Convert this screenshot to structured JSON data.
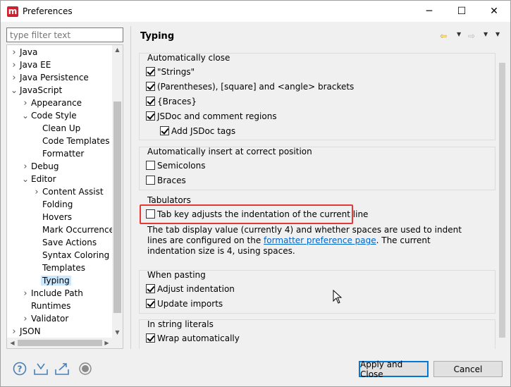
{
  "window": {
    "title": "Preferences",
    "minimize_glyph": "─",
    "maximize_glyph": "☐",
    "close_glyph": "✕",
    "app_icon_letter": "m"
  },
  "filter": {
    "placeholder": "type filter text",
    "value": ""
  },
  "tree": {
    "items": [
      {
        "label": "Java",
        "level": 0,
        "state": "collapsed"
      },
      {
        "label": "Java EE",
        "level": 0,
        "state": "collapsed"
      },
      {
        "label": "Java Persistence",
        "level": 0,
        "state": "collapsed"
      },
      {
        "label": "JavaScript",
        "level": 0,
        "state": "expanded"
      },
      {
        "label": "Appearance",
        "level": 1,
        "state": "collapsed"
      },
      {
        "label": "Code Style",
        "level": 1,
        "state": "expanded"
      },
      {
        "label": "Clean Up",
        "level": 2,
        "state": "leaf"
      },
      {
        "label": "Code Templates",
        "level": 2,
        "state": "leaf"
      },
      {
        "label": "Formatter",
        "level": 2,
        "state": "leaf"
      },
      {
        "label": "Debug",
        "level": 1,
        "state": "collapsed"
      },
      {
        "label": "Editor",
        "level": 1,
        "state": "expanded"
      },
      {
        "label": "Content Assist",
        "level": 2,
        "state": "collapsed"
      },
      {
        "label": "Folding",
        "level": 2,
        "state": "leaf"
      },
      {
        "label": "Hovers",
        "level": 2,
        "state": "leaf"
      },
      {
        "label": "Mark Occurrences",
        "level": 2,
        "state": "leaf"
      },
      {
        "label": "Save Actions",
        "level": 2,
        "state": "leaf"
      },
      {
        "label": "Syntax Coloring",
        "level": 2,
        "state": "leaf"
      },
      {
        "label": "Templates",
        "level": 2,
        "state": "leaf"
      },
      {
        "label": "Typing",
        "level": 2,
        "state": "leaf",
        "selected": true
      },
      {
        "label": "Include Path",
        "level": 1,
        "state": "collapsed"
      },
      {
        "label": "Runtimes",
        "level": 1,
        "state": "leaf"
      },
      {
        "label": "Validator",
        "level": 1,
        "state": "collapsed"
      },
      {
        "label": "JSON",
        "level": 0,
        "state": "collapsed"
      }
    ]
  },
  "page": {
    "title": "Typing",
    "back_icon": "back-arrow-icon",
    "forward_icon": "forward-arrow-icon"
  },
  "groups": {
    "auto_close": {
      "title": "Automatically close",
      "options": [
        {
          "label": "\"Strings\"",
          "checked": true
        },
        {
          "label": "(Parentheses), [square] and <angle> brackets",
          "checked": true
        },
        {
          "label": "{Braces}",
          "checked": true
        },
        {
          "label": "JSDoc and comment regions",
          "checked": true
        },
        {
          "label": "Add JSDoc tags",
          "checked": true
        }
      ]
    },
    "auto_insert": {
      "title": "Automatically insert at correct position",
      "options": [
        {
          "label": "Semicolons",
          "checked": false
        },
        {
          "label": "Braces",
          "checked": false
        }
      ]
    },
    "tabulators": {
      "title": "Tabulators",
      "option": {
        "label": "Tab key adjusts the indentation of the current line",
        "checked": false
      },
      "desc_before": "The tab display value (currently 4) and whether spaces are used to indent lines are configured on the ",
      "desc_link": "formatter preference page",
      "desc_after": ". The current indentation size is 4, using spaces."
    },
    "pasting": {
      "title": "When pasting",
      "options": [
        {
          "label": "Adjust indentation",
          "checked": true
        },
        {
          "label": "Update imports",
          "checked": true
        }
      ]
    },
    "string_literals": {
      "title": "In string literals",
      "options": [
        {
          "label": "Wrap automatically",
          "checked": true
        }
      ]
    }
  },
  "buttons": {
    "apply_close": "Apply and Close",
    "cancel": "Cancel"
  },
  "bottom_icons": [
    "help-icon",
    "import-icon",
    "export-icon",
    "record-icon"
  ],
  "colors": {
    "accent": "#0078d7",
    "highlight_border": "#e53935",
    "link": "#0066cc",
    "selection": "#cce8ff"
  }
}
